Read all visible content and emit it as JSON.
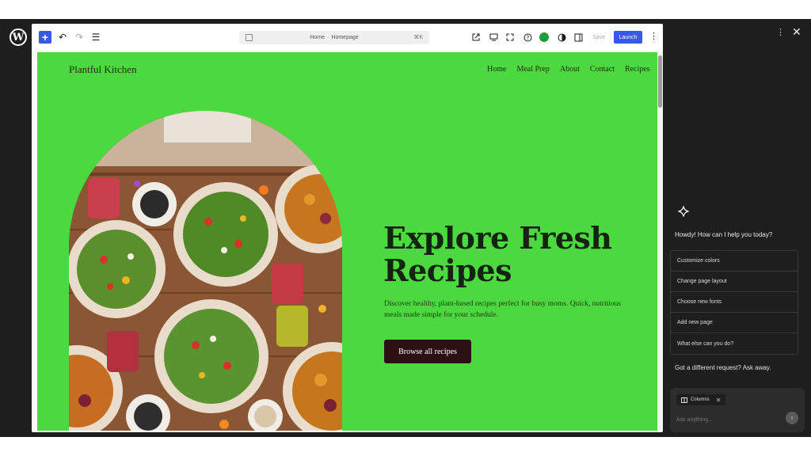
{
  "toolbar": {
    "add_label": "+",
    "document": {
      "page": "Home",
      "separator": "·",
      "template": "Homepage",
      "shortcut": "⌘K"
    },
    "save_label": "Save",
    "launch_label": "Launch",
    "colors": {
      "accent": "#3858e9",
      "status_green": "#1e9d3a"
    }
  },
  "site": {
    "title": "Plantful Kitchen",
    "nav": [
      "Home",
      "Meal Prep",
      "About",
      "Contact",
      "Recipes"
    ],
    "hero": {
      "heading_line1": "Explore Fresh",
      "heading_line2": "Recipes",
      "description": "Discover healthy, plant-based recipes perfect for busy moms. Quick, nutritious meals made simple for your schedule.",
      "button_label": "Browse all recipes"
    },
    "background_color": "#4cd93f"
  },
  "assistant": {
    "greeting": "Howdy! How can I help you today?",
    "suggestions": [
      "Customize colors",
      "Change page layout",
      "Choose new fonts",
      "Add new page",
      "What else can you do?"
    ],
    "alt_prompt": "Got a different request? Ask away.",
    "chip_label": "Columns",
    "input_placeholder": "Ask anything..."
  },
  "icons": [
    "wordpress-logo-icon",
    "undo-icon",
    "redo-icon",
    "list-view-icon",
    "external-link-icon",
    "desktop-preview-icon",
    "fullscreen-icon",
    "help-icon",
    "style-contrast-icon",
    "sidebar-toggle-icon",
    "more-options-icon",
    "sparkle-icon",
    "close-icon",
    "send-icon"
  ]
}
